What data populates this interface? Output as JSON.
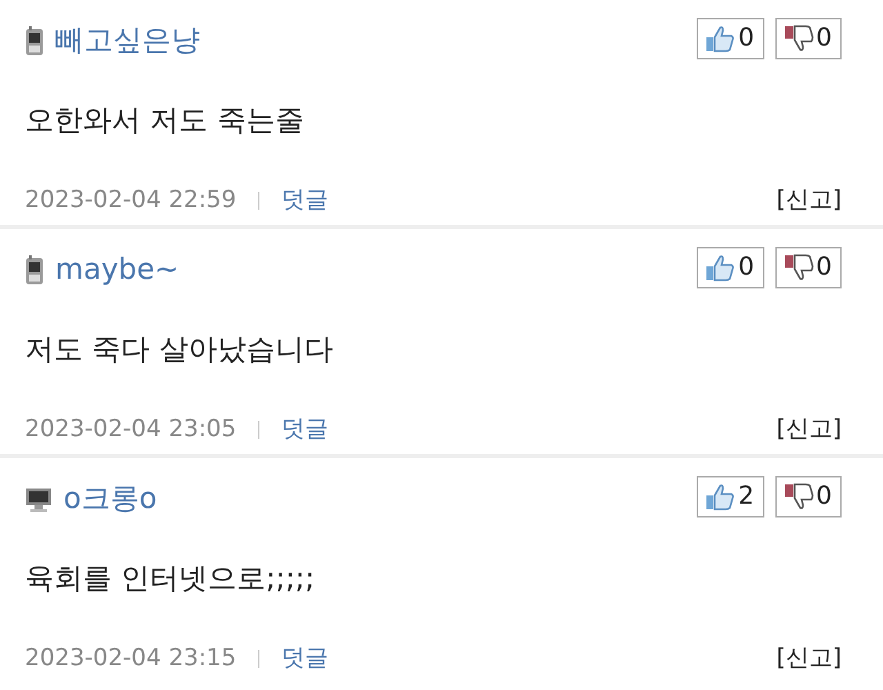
{
  "comments": [
    {
      "kind": "mobile",
      "author": "빼고싶은냥",
      "likes": "0",
      "dislikes": "0",
      "text": "오한와서 저도 죽는줄",
      "time": "2023-02-04 22:59",
      "reply": "덧글",
      "report": "[신고]"
    },
    {
      "kind": "mobile",
      "author": "maybe~",
      "likes": "0",
      "dislikes": "0",
      "text": "저도 죽다 살아났습니다",
      "time": "2023-02-04 23:05",
      "reply": "덧글",
      "report": "[신고]"
    },
    {
      "kind": "pc",
      "author": "o크롱o",
      "likes": "2",
      "dislikes": "0",
      "text": "육회를 인터넷으로;;;;;",
      "time": "2023-02-04 23:15",
      "reply": "덧글",
      "report": "[신고]"
    }
  ]
}
